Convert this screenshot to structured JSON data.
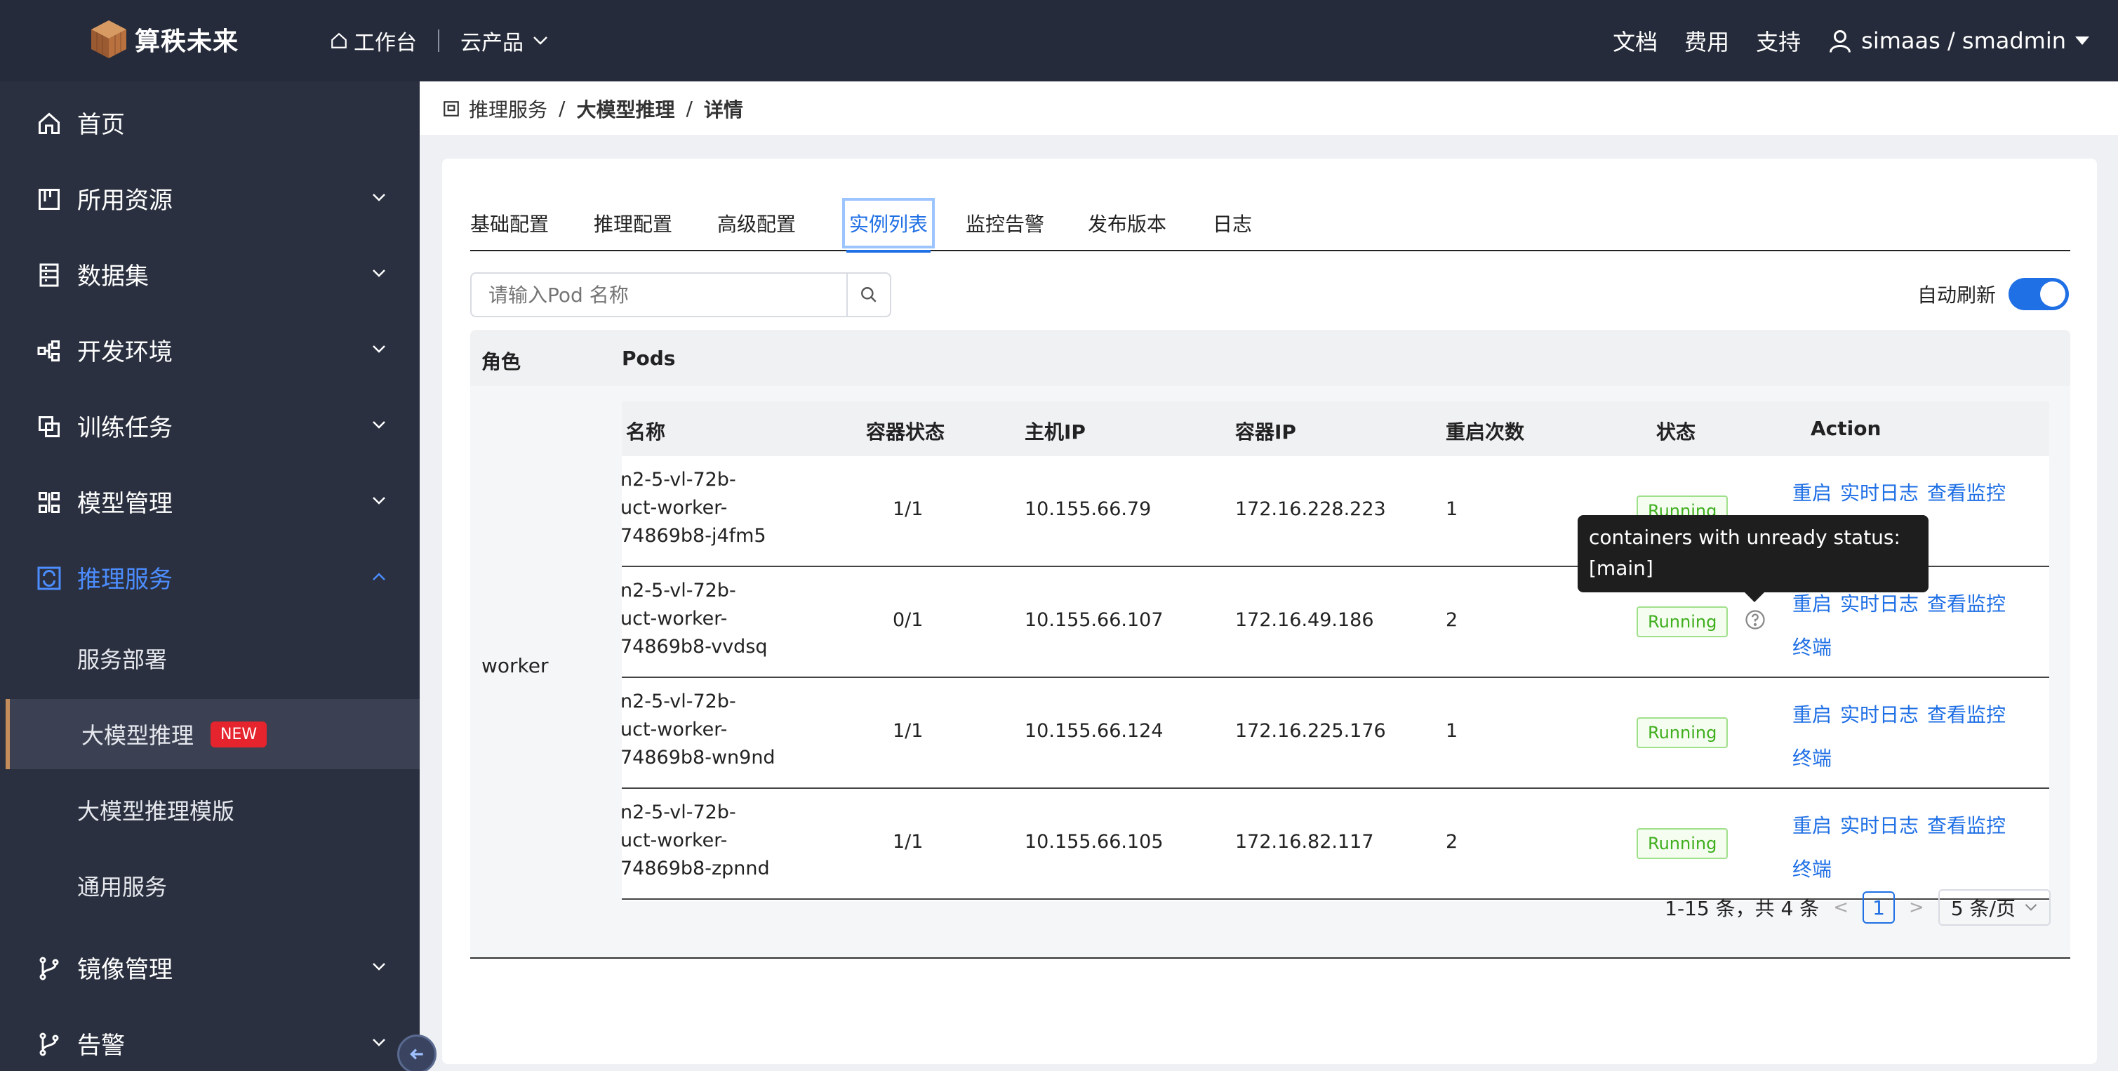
{
  "header": {
    "logo_text": "算秩未来",
    "home_link": "工作台",
    "products_menu": "云产品",
    "links": [
      "文档",
      "费用",
      "支持"
    ],
    "user": "simaas / smadmin"
  },
  "sidebar": {
    "items": [
      {
        "label": "首页",
        "icon": "home-icon"
      },
      {
        "label": "所用资源",
        "icon": "resource-icon"
      },
      {
        "label": "数据集",
        "icon": "dataset-icon"
      },
      {
        "label": "开发环境",
        "icon": "dev-env-icon"
      },
      {
        "label": "训练任务",
        "icon": "training-icon"
      },
      {
        "label": "模型管理",
        "icon": "model-icon"
      },
      {
        "label": "推理服务",
        "icon": "inference-icon"
      },
      {
        "label": "镜像管理",
        "icon": "image-icon"
      },
      {
        "label": "告警",
        "icon": "alert-icon"
      }
    ],
    "sub_items": [
      "服务部署",
      "大模型推理",
      "大模型推理模版",
      "通用服务"
    ],
    "new_badge": "NEW",
    "active_color": "#4c8dff"
  },
  "breadcrumb": [
    "推理服务",
    "大模型推理",
    "详情"
  ],
  "tabs": [
    "基础配置",
    "推理配置",
    "高级配置",
    "实例列表",
    "监控告警",
    "发布版本",
    "日志"
  ],
  "search": {
    "placeholder": "请输入Pod 名称"
  },
  "auto_refresh": {
    "label": "自动刷新",
    "enabled": true
  },
  "outer_table": {
    "headers": [
      "角色",
      "Pods"
    ],
    "role": "worker"
  },
  "inner_table": {
    "headers": [
      "名称",
      "容器状态",
      "主机IP",
      "容器IP",
      "重启次数",
      "状态",
      "Action"
    ],
    "rows": [
      {
        "name": [
          "n2-5-vl-72b-",
          "uct-worker-",
          "74869b8-j4fm5"
        ],
        "container_status": "1/1",
        "host_ip": "10.155.66.79",
        "pod_ip": "172.16.228.223",
        "restarts": "1",
        "status": "Running"
      },
      {
        "name": [
          "n2-5-vl-72b-",
          "uct-worker-",
          "74869b8-vvdsq"
        ],
        "container_status": "0/1",
        "host_ip": "10.155.66.107",
        "pod_ip": "172.16.49.186",
        "restarts": "2",
        "status": "Running"
      },
      {
        "name": [
          "n2-5-vl-72b-",
          "uct-worker-",
          "74869b8-wn9nd"
        ],
        "container_status": "1/1",
        "host_ip": "10.155.66.124",
        "pod_ip": "172.16.225.176",
        "restarts": "1",
        "status": "Running"
      },
      {
        "name": [
          "n2-5-vl-72b-",
          "uct-worker-",
          "74869b8-zpnnd"
        ],
        "container_status": "1/1",
        "host_ip": "10.155.66.105",
        "pod_ip": "172.16.82.117",
        "restarts": "2",
        "status": "Running"
      }
    ],
    "actions": [
      "重启",
      "实时日志",
      "查看监控",
      "终端"
    ]
  },
  "pagination": {
    "summary": "1-15 条，共 4 条",
    "current_page": "1",
    "page_size": "5 条/页"
  },
  "tooltip": {
    "line1": "containers with unready status:",
    "line2": "[main]"
  }
}
